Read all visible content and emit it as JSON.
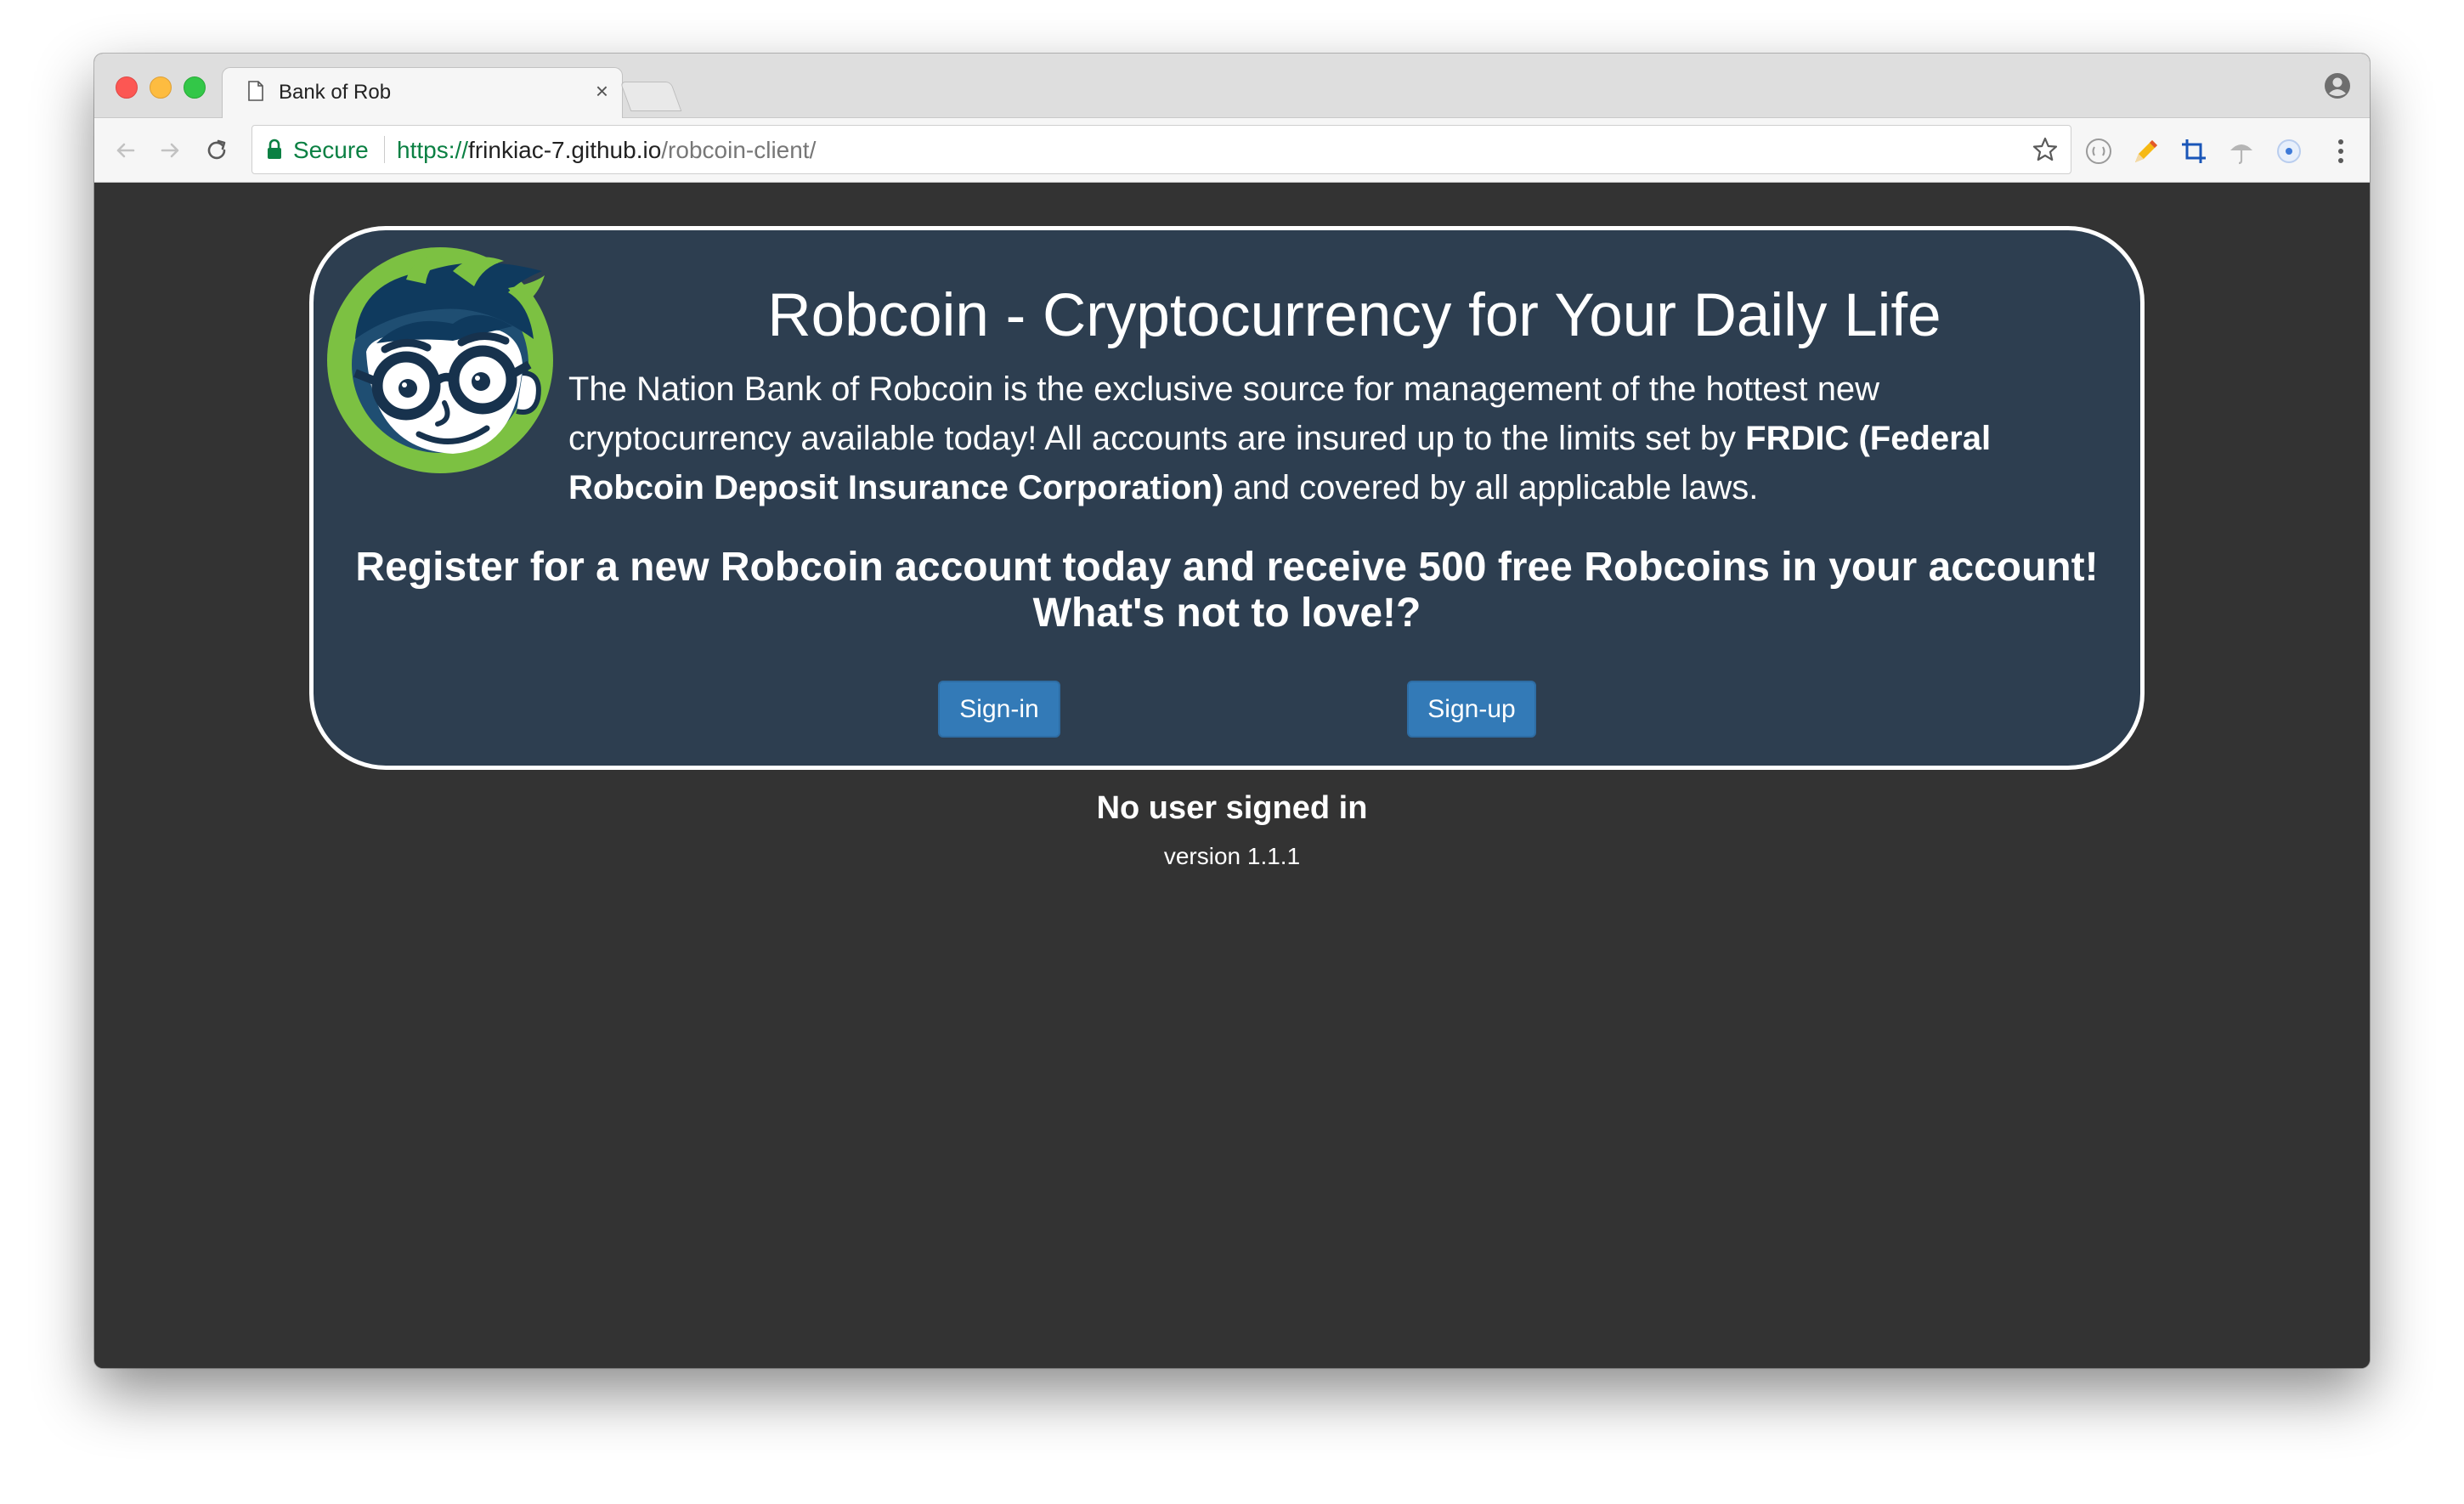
{
  "browser": {
    "tab": {
      "title": "Bank of Rob",
      "icon": "page-icon",
      "close_glyph": "×"
    },
    "omnibox": {
      "secure_label": "Secure",
      "url_scheme": "https://",
      "url_host": "frinkiac-7.github.io",
      "url_path": "/robcoin-client/"
    },
    "toolbar_icons": [
      "back-icon",
      "forward-icon",
      "reload-icon",
      "star-icon",
      "extension-icon",
      "pencil-icon",
      "crop-icon",
      "umbrella-icon",
      "circle-icon",
      "menu-icon"
    ]
  },
  "page": {
    "title": "Robcoin - Cryptocurrency for Your Daily Life",
    "description": {
      "text_before": "The Nation Bank of Robcoin is the exclusive source for management of the hottest new cryptocurrency available today! All accounts are insured up to the limits set by ",
      "bold": "FRDIC (Federal Robcoin Deposit Insurance Corporation)",
      "text_after": " and covered by all applicable laws."
    },
    "cta_line1": "Register for a new Robcoin account today and receive 500 free Robcoins in your account!",
    "cta_line2": "What's not to love!?",
    "signin_label": "Sign-in",
    "signup_label": "Sign-up",
    "status": "No user signed in",
    "version": "version 1.1.1"
  },
  "colors": {
    "page_background": "#333333",
    "hero_background": "#2d3e50",
    "button_primary": "#337ab7",
    "logo_green": "#7cc142",
    "secure_green": "#0b8043"
  }
}
